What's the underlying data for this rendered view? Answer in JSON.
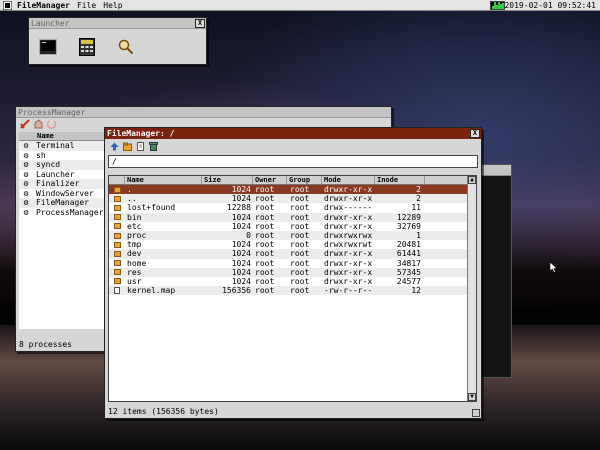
{
  "menubar": {
    "app_name": "FileManager",
    "menus": [
      "File",
      "Help"
    ],
    "clock": "2019-02-01 09:52:41"
  },
  "launcher": {
    "title": "Launcher",
    "close_label": "X",
    "icons": [
      "terminal-icon",
      "calculator-icon",
      "search-icon"
    ]
  },
  "process_manager": {
    "title": "ProcessManager",
    "column_name": "Name",
    "processes": [
      "Terminal",
      "sh",
      "syncd",
      "Launcher",
      "Finalizer",
      "WindowServer",
      "FileManager",
      "ProcessManager"
    ],
    "status": "8 processes"
  },
  "file_manager": {
    "title": "FileManager: /",
    "close_label": "X",
    "location": "/",
    "columns": {
      "name": "Name",
      "size": "Size",
      "owner": "Owner",
      "group": "Group",
      "mode": "Mode",
      "inode": "Inode"
    },
    "files": [
      {
        "name": ".",
        "size": "1024",
        "owner": "root",
        "group": "root",
        "mode": "drwxr-xr-x",
        "inode": "2",
        "type": "folder"
      },
      {
        "name": "..",
        "size": "1024",
        "owner": "root",
        "group": "root",
        "mode": "drwxr-xr-x",
        "inode": "2",
        "type": "folder"
      },
      {
        "name": "lost+found",
        "size": "12288",
        "owner": "root",
        "group": "root",
        "mode": "drwx------",
        "inode": "11",
        "type": "folder"
      },
      {
        "name": "bin",
        "size": "1024",
        "owner": "root",
        "group": "root",
        "mode": "drwxr-xr-x",
        "inode": "12289",
        "type": "folder"
      },
      {
        "name": "etc",
        "size": "1024",
        "owner": "root",
        "group": "root",
        "mode": "drwxr-xr-x",
        "inode": "32769",
        "type": "folder"
      },
      {
        "name": "proc",
        "size": "0",
        "owner": "root",
        "group": "root",
        "mode": "drwxrwxrwx",
        "inode": "1",
        "type": "folder"
      },
      {
        "name": "tmp",
        "size": "1024",
        "owner": "root",
        "group": "root",
        "mode": "drwxrwxrwt",
        "inode": "20481",
        "type": "folder"
      },
      {
        "name": "dev",
        "size": "1024",
        "owner": "root",
        "group": "root",
        "mode": "drwxr-xr-x",
        "inode": "61441",
        "type": "folder"
      },
      {
        "name": "home",
        "size": "1024",
        "owner": "root",
        "group": "root",
        "mode": "drwxr-xr-x",
        "inode": "34817",
        "type": "folder"
      },
      {
        "name": "res",
        "size": "1024",
        "owner": "root",
        "group": "root",
        "mode": "drwxr-xr-x",
        "inode": "57345",
        "type": "folder"
      },
      {
        "name": "usr",
        "size": "1024",
        "owner": "root",
        "group": "root",
        "mode": "drwxr-xr-x",
        "inode": "24577",
        "type": "folder"
      },
      {
        "name": "kernel.map",
        "size": "156356",
        "owner": "root",
        "group": "root",
        "mode": "-rw-r--r--",
        "inode": "12",
        "type": "file"
      }
    ],
    "status": "12 items (156356 bytes)"
  },
  "colors": {
    "active_titlebar": "#7a2410",
    "selected_row": "#8a3a20",
    "folder": "#e8a23a"
  }
}
